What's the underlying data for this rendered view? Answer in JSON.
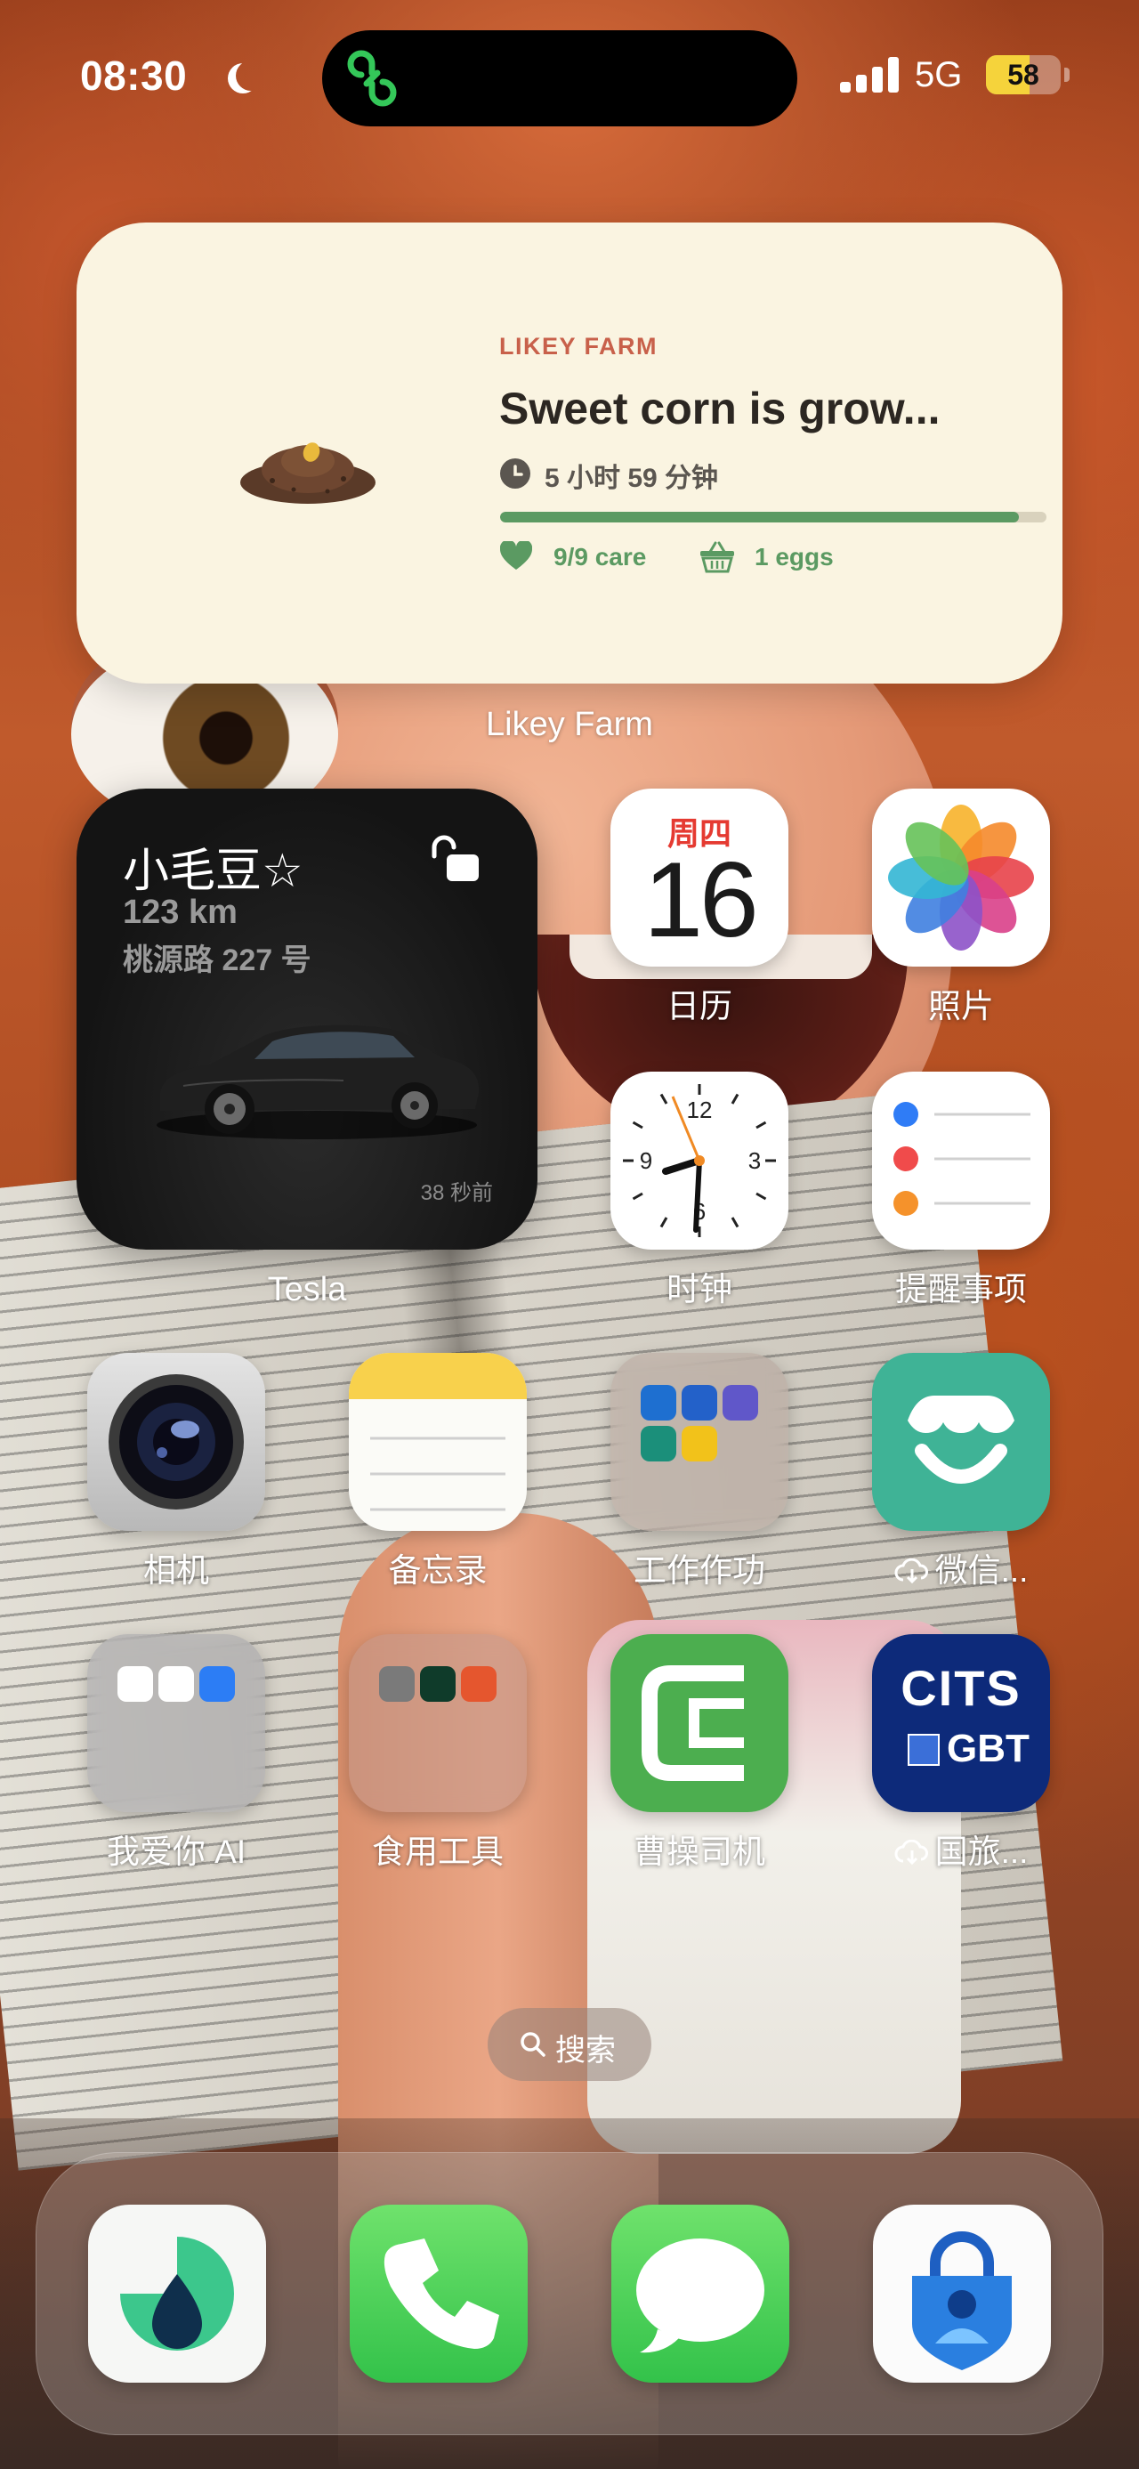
{
  "status_bar": {
    "time": "08:30",
    "network": "5G",
    "battery": "58",
    "battery_level": 0.58
  },
  "farm_widget": {
    "brand": "LIKEY FARM",
    "title": "Sweet corn is grow...",
    "timer": "5 小时 59 分钟",
    "progress": 0.95,
    "care": "9/9 care",
    "eggs": "1 eggs",
    "caption": "Likey Farm"
  },
  "tesla_widget": {
    "name": "小毛豆☆",
    "range": "123 km",
    "location": "桃源路 227 号",
    "updated": "38 秒前",
    "caption": "Tesla"
  },
  "apps": {
    "calendar": {
      "label": "日历",
      "day": "周四",
      "date": "16"
    },
    "photos": {
      "label": "照片"
    },
    "clock": {
      "label": "时钟"
    },
    "reminders": {
      "label": "提醒事项"
    },
    "camera": {
      "label": "相机"
    },
    "notes": {
      "label": "备忘录"
    },
    "work_folder": {
      "label": "工作作功"
    },
    "wechat_store": {
      "label": "微信..."
    },
    "ai_folder": {
      "label": "我爱你 AI"
    },
    "tools_folder": {
      "label": "食用工具"
    },
    "caocao": {
      "label": "曹操司机"
    },
    "cits": {
      "label": "国旅...",
      "logo_top": "CITS",
      "logo_bottom": "GBT"
    }
  },
  "search": {
    "label": "搜索"
  },
  "dock": {
    "items": [
      "app-1",
      "phone",
      "messages",
      "authenticator"
    ]
  },
  "colors": {
    "farm_bg": "#faf4e1",
    "farm_brand": "#c8604a",
    "farm_green": "#5b9a62",
    "battery": "#f5d33b"
  }
}
